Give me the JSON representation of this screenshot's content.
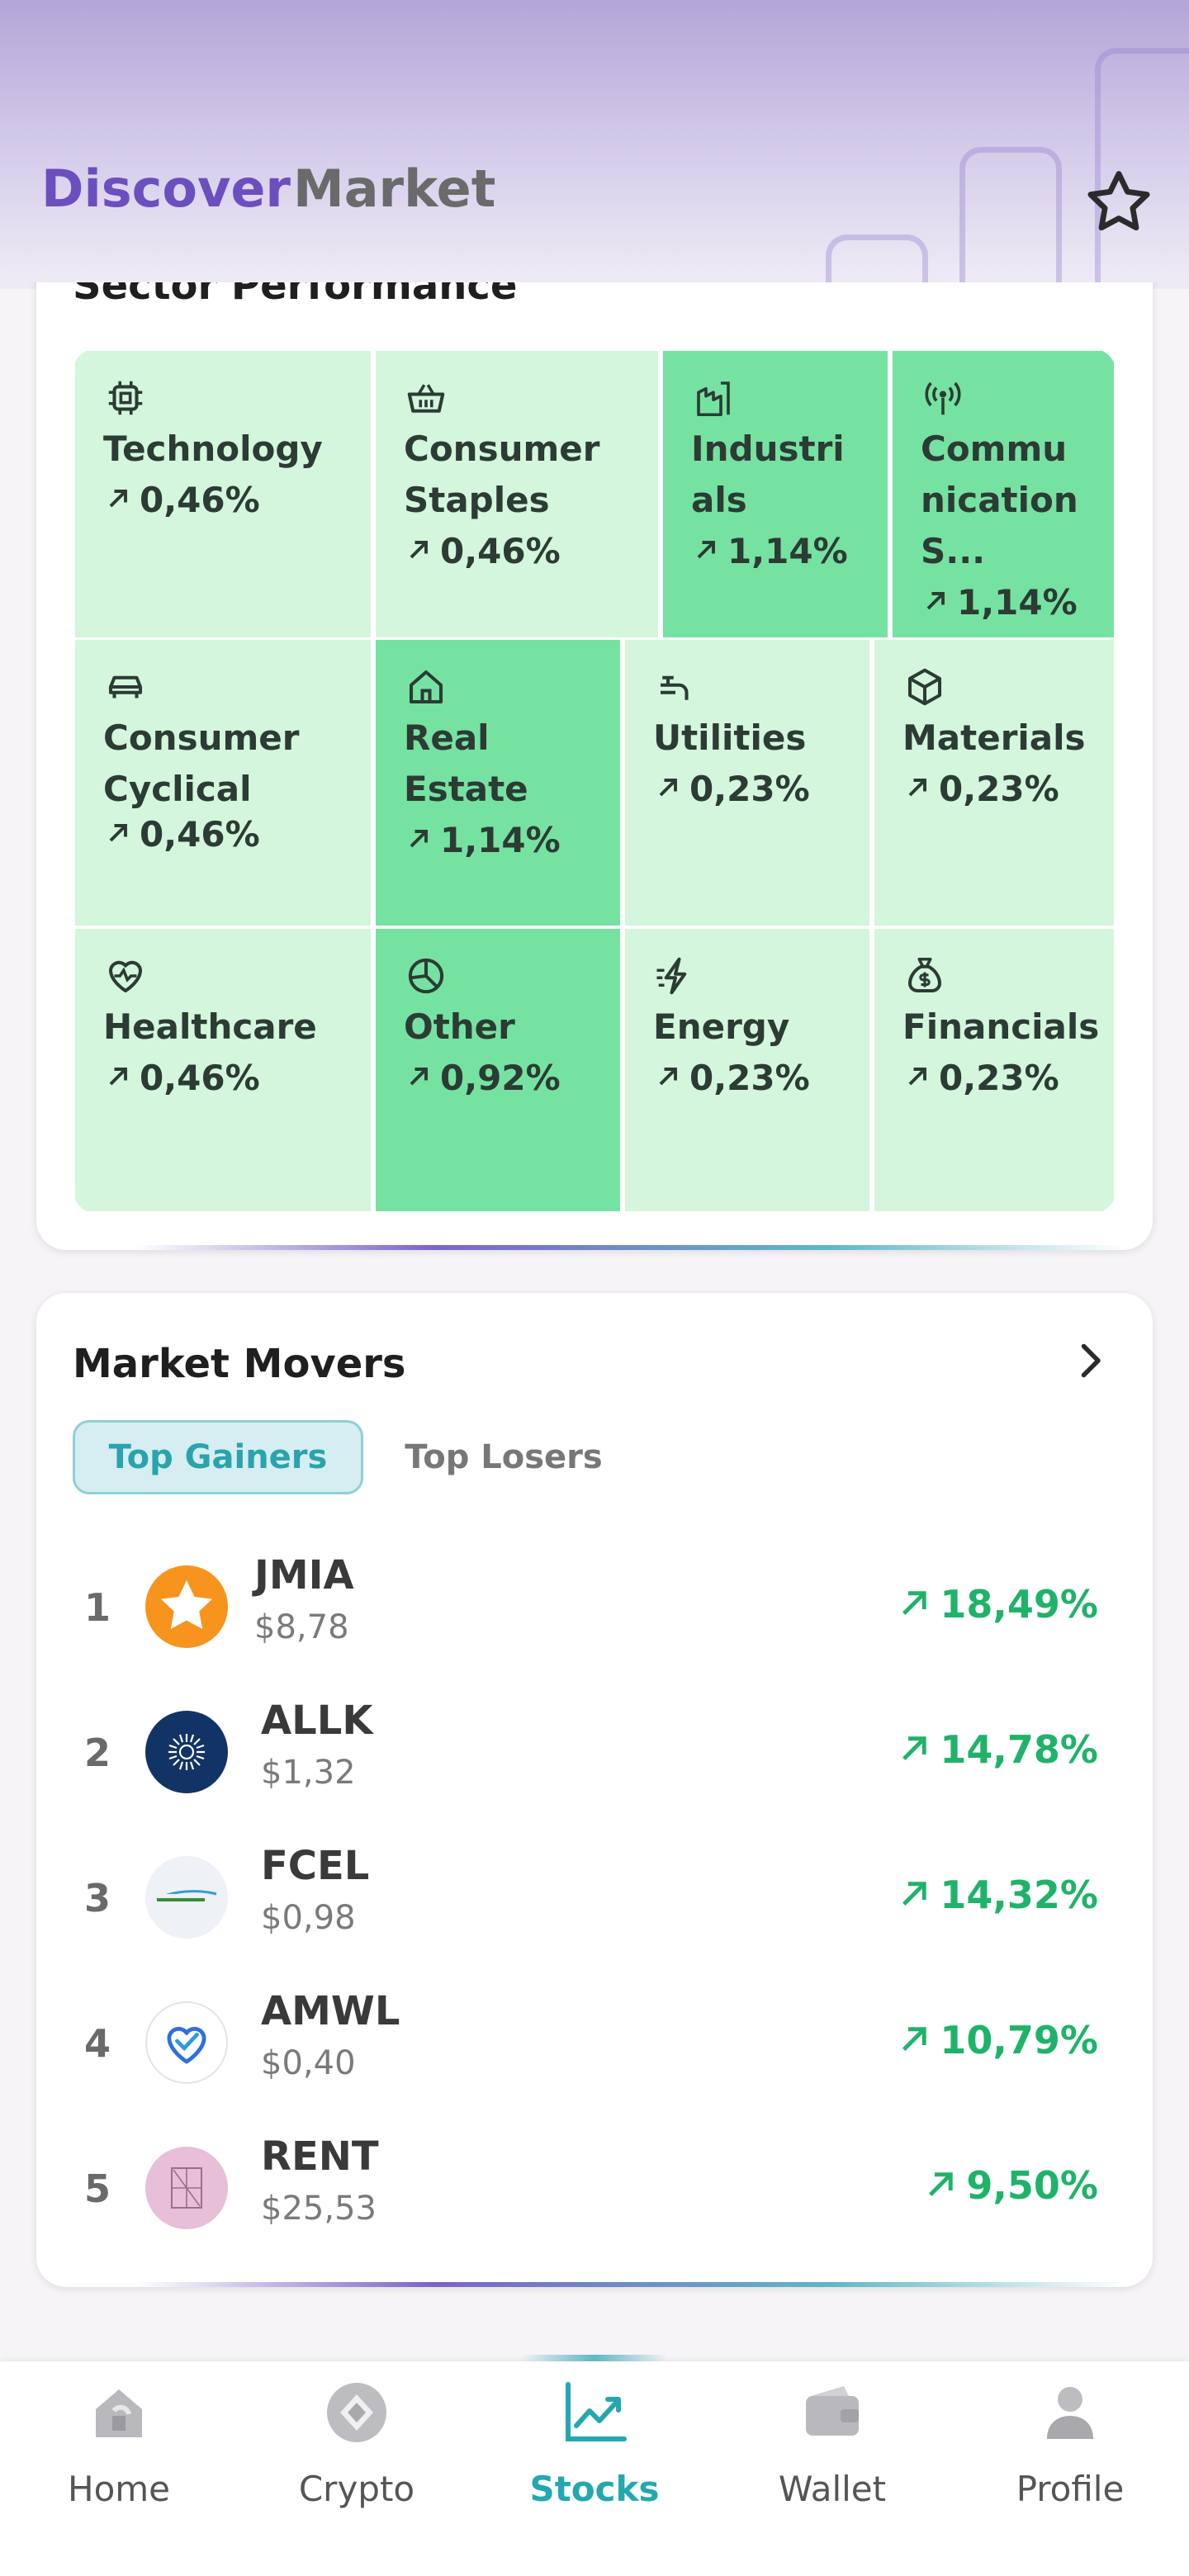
{
  "header": {
    "tabs": [
      {
        "label": "Discover",
        "active": true
      },
      {
        "label": "Market",
        "active": false
      }
    ],
    "favorite_icon": "star-icon"
  },
  "sector_performance": {
    "title": "Sector Performance",
    "tiles": [
      {
        "name": "Technology",
        "value": "0,46%",
        "icon": "chip-icon",
        "highlight": false
      },
      {
        "name": "Consumer Staples",
        "value": "0,46%",
        "icon": "basket-icon",
        "highlight": false
      },
      {
        "name": "Industrials",
        "value": "1,14%",
        "icon": "factory-icon",
        "highlight": true
      },
      {
        "name": "Communication S...",
        "value": "1,14%",
        "icon": "antenna-icon",
        "highlight": true
      },
      {
        "name": "Consumer Cyclical",
        "value": "0,46%",
        "icon": "car-icon",
        "highlight": false
      },
      {
        "name": "Real Estate",
        "value": "1,14%",
        "icon": "house-icon",
        "highlight": true
      },
      {
        "name": "Utilities",
        "value": "0,23%",
        "icon": "faucet-icon",
        "highlight": false
      },
      {
        "name": "Materials",
        "value": "0,23%",
        "icon": "cube-icon",
        "highlight": false
      },
      {
        "name": "Healthcare",
        "value": "0,46%",
        "icon": "heart-pulse-icon",
        "highlight": false
      },
      {
        "name": "Other",
        "value": "0,92%",
        "icon": "pie-icon",
        "highlight": true
      },
      {
        "name": "Energy",
        "value": "0,23%",
        "icon": "bolt-icon",
        "highlight": false
      },
      {
        "name": "Financials",
        "value": "0,23%",
        "icon": "money-bag-icon",
        "highlight": false
      }
    ]
  },
  "market_movers": {
    "title": "Market Movers",
    "tabs": {
      "gainers": "Top Gainers",
      "losers": "Top Losers"
    },
    "rows": [
      {
        "rank": "1",
        "symbol": "JMIA",
        "price": "$8,78",
        "change": "18,49%",
        "logo": "jumia-logo",
        "logo_color": "#f7941d"
      },
      {
        "rank": "2",
        "symbol": "ALLK",
        "price": "$1,32",
        "change": "14,78%",
        "logo": "allakos-logo",
        "logo_color": "#123366"
      },
      {
        "rank": "3",
        "symbol": "FCEL",
        "price": "$0,98",
        "change": "14,32%",
        "logo": "fuelcell-logo",
        "logo_color": "#eef1f5"
      },
      {
        "rank": "4",
        "symbol": "AMWL",
        "price": "$0,40",
        "change": "10,79%",
        "logo": "amwell-logo",
        "logo_color": "#ffffff"
      },
      {
        "rank": "5",
        "symbol": "RENT",
        "price": "$25,53",
        "change": "9,50%",
        "logo": "rent-logo",
        "logo_color": "#e8bfd8"
      }
    ]
  },
  "bottom_nav": [
    {
      "label": "Home",
      "icon": "home-icon",
      "active": false
    },
    {
      "label": "Crypto",
      "icon": "crypto-icon",
      "active": false
    },
    {
      "label": "Stocks",
      "icon": "stocks-chart-icon",
      "active": true
    },
    {
      "label": "Wallet",
      "icon": "wallet-icon",
      "active": false
    },
    {
      "label": "Profile",
      "icon": "profile-icon",
      "active": false
    }
  ],
  "colors": {
    "accent_purple": "#6b4fbf",
    "accent_teal": "#23a8b0",
    "gain_green": "#1fb36a",
    "tile_light": "#d3f6dc",
    "tile_strong": "#76e2a2"
  }
}
